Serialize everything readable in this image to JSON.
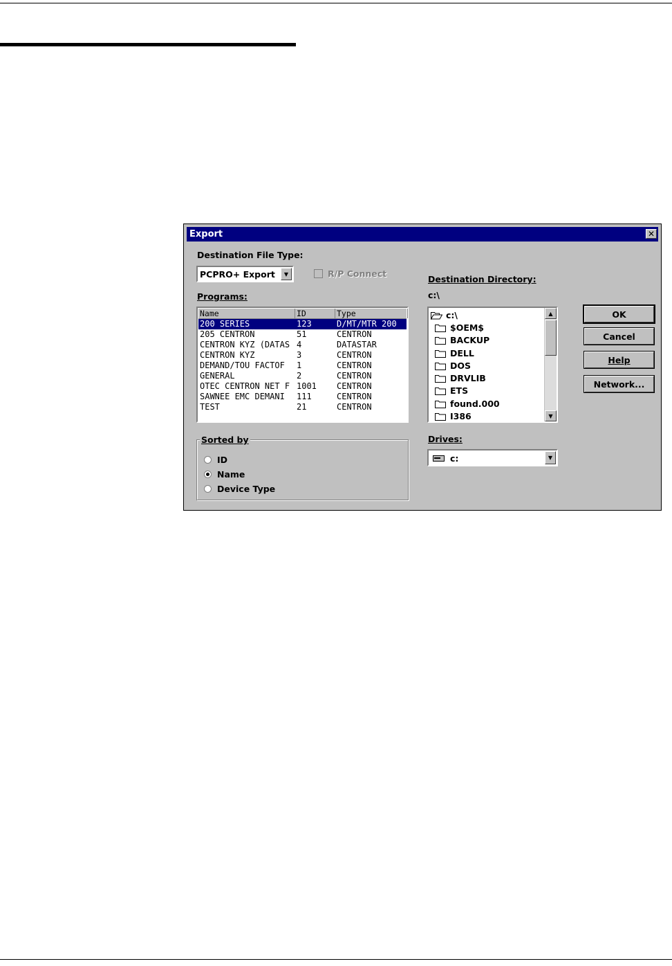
{
  "dialog": {
    "title": "Export",
    "close_glyph": "✕",
    "dest_file_type_label": "Destination File Type:",
    "file_type_value": "PCPRO+ Export",
    "rp_connect_label": "R/P Connect",
    "programs_label": "Programs:",
    "programs": {
      "columns": [
        "Name",
        "ID",
        "Type"
      ],
      "rows": [
        {
          "name": "200 SERIES",
          "id": "123",
          "type": "D/MT/MTR 200"
        },
        {
          "name": "205 CENTRON",
          "id": "51",
          "type": "CENTRON"
        },
        {
          "name": "CENTRON KYZ (DATAS",
          "id": "4",
          "type": "DATASTAR"
        },
        {
          "name": "CENTRON KYZ",
          "id": "3",
          "type": "CENTRON"
        },
        {
          "name": "DEMAND/TOU FACTOF",
          "id": "1",
          "type": "CENTRON"
        },
        {
          "name": "GENERAL",
          "id": "2",
          "type": "CENTRON"
        },
        {
          "name": "OTEC CENTRON NET F",
          "id": "1001",
          "type": "CENTRON"
        },
        {
          "name": "SAWNEE EMC DEMANI",
          "id": "111",
          "type": "CENTRON"
        },
        {
          "name": "TEST",
          "id": "21",
          "type": "CENTRON"
        }
      ]
    },
    "sorted_by": {
      "label": "Sorted by",
      "options": [
        "ID",
        "Name",
        "Device Type"
      ],
      "selected": "Name"
    },
    "dest_dir_label": "Destination Directory:",
    "current_dir": "c:\\",
    "directories": [
      "c:\\",
      "$OEM$",
      "BACKUP",
      "DELL",
      "DOS",
      "DRVLIB",
      "ETS",
      "found.000",
      "I386"
    ],
    "drives_label": "Drives:",
    "drive_value": "c:",
    "buttons": {
      "ok": "OK",
      "cancel": "Cancel",
      "help": "Help",
      "network": "Network..."
    }
  }
}
